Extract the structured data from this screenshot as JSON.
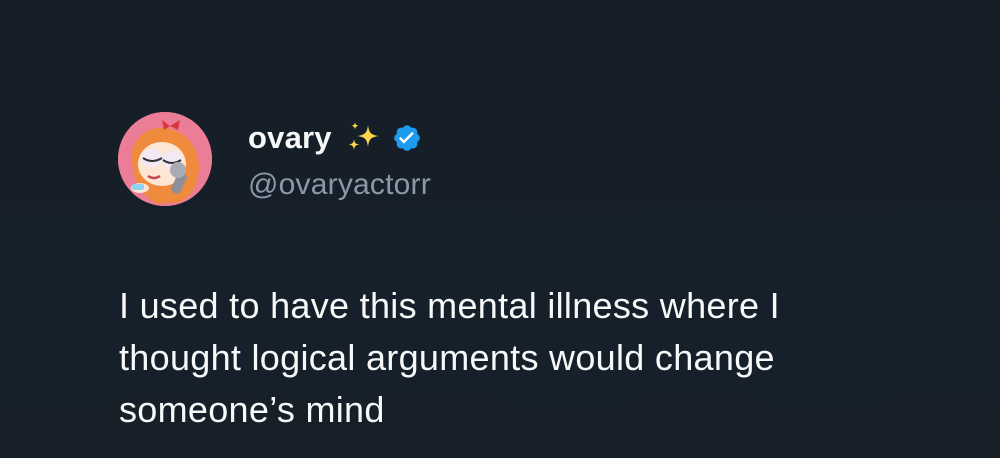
{
  "author": {
    "display_name": "ovary",
    "handle": "@ovaryactorr",
    "avatar_icon": "cartoon-avatar-icon",
    "emoji_icon": "sparkles-icon",
    "badge_icon": "verified-badge-icon",
    "badge_color": "#1d9bf0"
  },
  "tweet": {
    "lines": [
      "I used to have this mental illness where I",
      "thought logical arguments would change",
      "someone’s mind"
    ]
  },
  "theme": {
    "background": "#15202b",
    "text": "#f7f9f9",
    "secondary_text": "#8b98a5"
  }
}
